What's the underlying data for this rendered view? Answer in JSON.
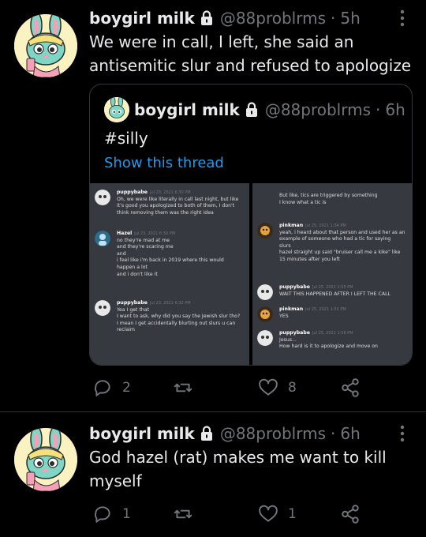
{
  "tweet1": {
    "name": "boygirl milk",
    "handle": "@88problrms",
    "dot": "·",
    "time": "5h",
    "text": "We were in call, I left, she said an antisemitic slur and refused to apologize",
    "quote": {
      "name": "boygirl milk",
      "handle": "@88problrms",
      "dot": "·",
      "time": "6h",
      "text": "#silly",
      "link": "Show this thread",
      "left_messages": [
        {
          "user": "puppybabe",
          "time": "Jul 23, 2021 6:30 PM",
          "lines": [
            "Oh, we were like literally in call last night, but like",
            "it's good you apologized to both of them, I don't",
            "think removing them was the right idea"
          ]
        },
        {
          "user": "Hazel",
          "time": "Jul 23, 2021 6:30 PM",
          "lines": [
            "no they're mad at me",
            "and they're scaring me",
            "and",
            "i feel like i'm back in 2019 where this would",
            "happen a lot",
            "and i don't like it"
          ]
        },
        {
          "user": "puppybabe",
          "time": "Jul 23, 2021 6:32 PM",
          "lines": [
            "Yea I get that",
            "",
            "I want to ask, why did you say the Jewish slur tho?",
            "I mean I get accidentally blurting out slurs u can",
            "reclaim"
          ]
        }
      ],
      "right_messages": [
        {
          "user": "",
          "time": "",
          "lines": [
            "But like, tics are triggered by something",
            "",
            "I know what a tic is"
          ]
        },
        {
          "user": "pinkman",
          "time": "Jul 25, 2021 1:54 PM",
          "lines": [
            "yeah, i heard about that person and used her as an",
            "example of someone who had a tic for saying",
            "slurs",
            "hazel straight up said \"bruiser call me a kike\" like",
            "15 minutes after you left"
          ]
        },
        {
          "user": "puppybabe",
          "time": "Jul 25, 2021 1:55 PM",
          "lines": [
            "WAIT THIS HAPPENED AFTER I LEFT THE CALL"
          ]
        },
        {
          "user": "pinkman",
          "time": "Jul 25, 2021 1:55 PM",
          "lines": [
            "YES"
          ]
        },
        {
          "user": "puppybabe",
          "time": "Jul 25, 2021 1:58 PM",
          "lines": [
            "Jesus...",
            "How hard is it to apologize and move on"
          ]
        }
      ]
    },
    "actions": {
      "replies": "2",
      "retweets": "",
      "likes": "8"
    }
  },
  "tweet2": {
    "name": "boygirl milk",
    "handle": "@88problrms",
    "dot": "·",
    "time": "6h",
    "text": "God hazel (rat) makes me want to kill myself",
    "actions": {
      "replies": "1",
      "retweets": "",
      "likes": "1"
    }
  },
  "colors": {
    "background": "#000000",
    "text": "#e7e9ea",
    "muted": "#71767b",
    "link": "#1d9bf0",
    "discord_bg": "#36393f"
  }
}
